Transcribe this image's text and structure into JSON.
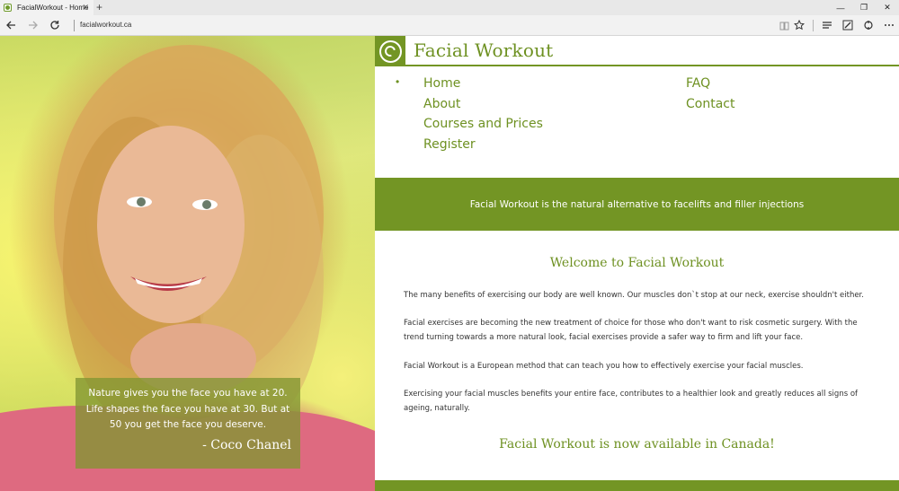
{
  "browser": {
    "tab_title": "FacialWorkout - Home",
    "tab_close": "✕",
    "new_tab": "+",
    "url": "facialworkout.ca",
    "window_controls": [
      "—",
      "❐",
      "✕"
    ]
  },
  "site": {
    "title": "Facial Workout",
    "nav_left": [
      "Home",
      "About",
      "Courses and Prices",
      "Register"
    ],
    "nav_right": [
      "FAQ",
      "Contact"
    ],
    "active_nav": "Home",
    "banner": "Facial Workout is the natural alternative to facelifts and filler injections",
    "welcome_title": "Welcome to Facial Workout",
    "paragraphs": [
      "The many benefits of exercising our body are well known. Our muscles don`t stop at our neck, exercise shouldn't either.",
      "Facial exercises are becoming the new treatment of choice for those who don't want to risk cosmetic surgery. With the trend turning towards a more natural look, facial exercises provide a safer way to firm and lift your face.",
      "Facial Workout is a European method that can teach you how to effectively exercise your facial muscles.",
      "Exercising your facial muscles benefits your entire face, contributes to a healthier look and greatly reduces all signs of ageing, naturally."
    ],
    "available": "Facial Workout is now available in Canada!",
    "quote": "Nature gives you the face you have at 20. Life shapes the face you have at 30. But at 50 you get the face you deserve.",
    "quote_author": "- Coco Chanel"
  },
  "colors": {
    "brand_green": "#739524",
    "text_green": "#6e9122"
  },
  "icons": {
    "back": "arrow-left-icon",
    "forward": "arrow-right-icon",
    "refresh": "refresh-icon",
    "reading_view": "book-icon",
    "favorite": "star-icon",
    "hub": "hub-icon",
    "notes": "pen-icon",
    "share": "share-icon",
    "more": "more-icon"
  }
}
